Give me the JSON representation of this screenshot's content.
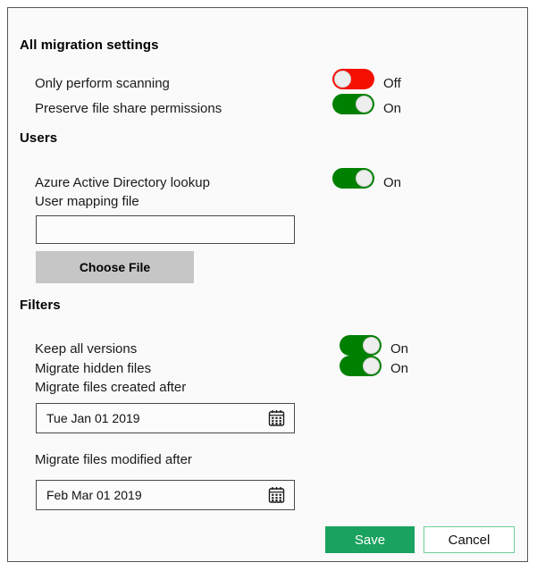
{
  "sections": {
    "migration": {
      "title": "All migration settings",
      "rows": [
        {
          "label": "Only perform scanning",
          "state": "Off",
          "on": false
        },
        {
          "label": "Preserve file share permissions",
          "state": "On",
          "on": true
        }
      ]
    },
    "users": {
      "title": "Users",
      "rows": [
        {
          "label": "Azure Active Directory lookup",
          "state": "On",
          "on": true
        }
      ],
      "mapping_label": "User mapping file",
      "mapping_value": "",
      "mapping_placeholder": "",
      "choose_file_label": "Choose File"
    },
    "filters": {
      "title": "Filters",
      "rows": [
        {
          "label": "Keep all versions",
          "state": "On",
          "on": true
        },
        {
          "label": "Migrate hidden files",
          "state": "On",
          "on": true
        }
      ],
      "created_label": "Migrate files created after",
      "created_value": "Tue Jan 01 2019",
      "modified_label": "Migrate files modified after",
      "modified_value": "Feb Mar 01 2019"
    }
  },
  "footer": {
    "save_label": "Save",
    "cancel_label": "Cancel"
  },
  "icons": {
    "calendar": "calendar-icon"
  },
  "colors": {
    "toggle_on": "#008000",
    "toggle_off": "#f41000",
    "save_bg": "#1aa260",
    "cancel_border": "#6fcf97",
    "choose_file_bg": "#c6c6c6",
    "panel_bg": "#fafafa",
    "panel_border": "#555555"
  }
}
